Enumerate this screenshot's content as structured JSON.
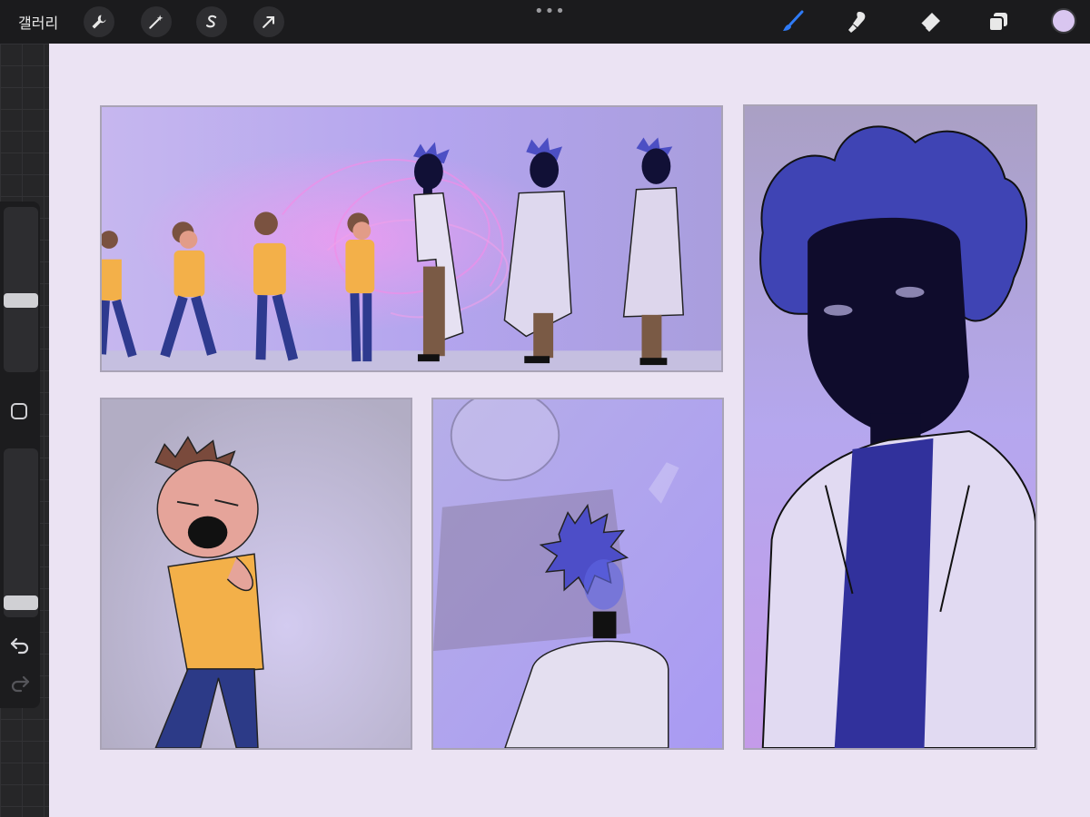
{
  "topbar": {
    "gallery_label": "갤러리",
    "left_tools": [
      {
        "name": "actions",
        "icon": "wrench-icon"
      },
      {
        "name": "adjustments",
        "icon": "magic-wand-icon"
      },
      {
        "name": "selection",
        "icon": "selection-s-icon"
      },
      {
        "name": "transform",
        "icon": "arrow-cursor-icon"
      }
    ],
    "more_label": "•••",
    "right_tools": [
      {
        "name": "brush",
        "icon": "brush-icon",
        "active": true
      },
      {
        "name": "smudge",
        "icon": "smudge-icon"
      },
      {
        "name": "eraser",
        "icon": "eraser-icon"
      },
      {
        "name": "layers",
        "icon": "layers-icon"
      }
    ],
    "active_color": "#d9c6f0",
    "accent_color": "#2f7bf6"
  },
  "sidebar": {
    "brush_size_level": 0.42,
    "opacity_level": 0.0,
    "modify_icon": "square-icon",
    "undo_icon": "undo-icon",
    "redo_icon": "redo-icon"
  },
  "canvas": {
    "background": "#ebe3f3",
    "panels": [
      {
        "name": "lineup-panel",
        "description_icon": "illustration"
      },
      {
        "name": "boy-panel",
        "description_icon": "illustration"
      },
      {
        "name": "figure-back-panel",
        "description_icon": "illustration"
      },
      {
        "name": "shadow-face-panel",
        "description_icon": "illustration"
      }
    ]
  }
}
